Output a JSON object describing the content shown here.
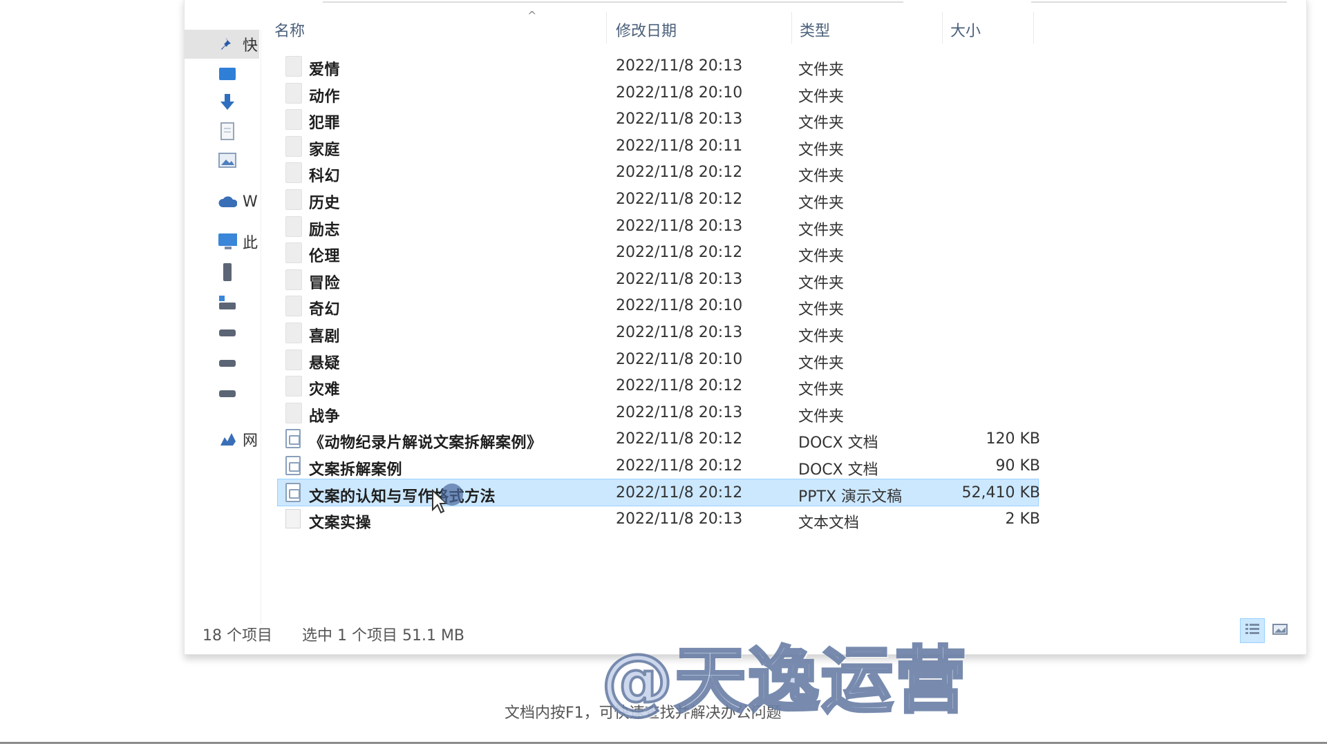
{
  "header": {
    "col_name": "名称",
    "col_date": "修改日期",
    "col_type": "类型",
    "col_size": "大小"
  },
  "sidebar": {
    "items": [
      {
        "icon": "pin-icon",
        "label": "快"
      },
      {
        "icon": "desktop-icon",
        "label": ""
      },
      {
        "icon": "download-arrow-icon",
        "label": ""
      },
      {
        "icon": "document-icon",
        "label": ""
      },
      {
        "icon": "pictures-icon",
        "label": ""
      },
      {
        "icon": "cloud-icon",
        "label": "W"
      },
      {
        "icon": "computer-icon",
        "label": "此"
      },
      {
        "icon": "usb-drive-icon",
        "label": ""
      },
      {
        "icon": "network-drive-icon",
        "label": ""
      },
      {
        "icon": "disk-icon",
        "label": ""
      },
      {
        "icon": "disk-icon",
        "label": ""
      },
      {
        "icon": "disk-icon",
        "label": ""
      },
      {
        "icon": "network-icon",
        "label": "网"
      }
    ]
  },
  "files": [
    {
      "name": "爱情",
      "date": "2022/11/8 20:13",
      "type": "文件夹",
      "size": "",
      "kind": "folder"
    },
    {
      "name": "动作",
      "date": "2022/11/8 20:10",
      "type": "文件夹",
      "size": "",
      "kind": "folder"
    },
    {
      "name": "犯罪",
      "date": "2022/11/8 20:13",
      "type": "文件夹",
      "size": "",
      "kind": "folder"
    },
    {
      "name": "家庭",
      "date": "2022/11/8 20:11",
      "type": "文件夹",
      "size": "",
      "kind": "folder"
    },
    {
      "name": "科幻",
      "date": "2022/11/8 20:12",
      "type": "文件夹",
      "size": "",
      "kind": "folder"
    },
    {
      "name": "历史",
      "date": "2022/11/8 20:12",
      "type": "文件夹",
      "size": "",
      "kind": "folder"
    },
    {
      "name": "励志",
      "date": "2022/11/8 20:13",
      "type": "文件夹",
      "size": "",
      "kind": "folder"
    },
    {
      "name": "伦理",
      "date": "2022/11/8 20:12",
      "type": "文件夹",
      "size": "",
      "kind": "folder"
    },
    {
      "name": "冒险",
      "date": "2022/11/8 20:13",
      "type": "文件夹",
      "size": "",
      "kind": "folder"
    },
    {
      "name": "奇幻",
      "date": "2022/11/8 20:10",
      "type": "文件夹",
      "size": "",
      "kind": "folder"
    },
    {
      "name": "喜剧",
      "date": "2022/11/8 20:13",
      "type": "文件夹",
      "size": "",
      "kind": "folder"
    },
    {
      "name": "悬疑",
      "date": "2022/11/8 20:10",
      "type": "文件夹",
      "size": "",
      "kind": "folder"
    },
    {
      "name": "灾难",
      "date": "2022/11/8 20:12",
      "type": "文件夹",
      "size": "",
      "kind": "folder"
    },
    {
      "name": "战争",
      "date": "2022/11/8 20:13",
      "type": "文件夹",
      "size": "",
      "kind": "folder"
    },
    {
      "name": "《动物纪录片解说文案拆解案例》",
      "date": "2022/11/8 20:12",
      "type": "DOCX 文档",
      "size": "120 KB",
      "kind": "docx"
    },
    {
      "name": "文案拆解案例",
      "date": "2022/11/8 20:12",
      "type": "DOCX 文档",
      "size": "90 KB",
      "kind": "docx"
    },
    {
      "name": "文案的认知与写作格式方法",
      "date": "2022/11/8 20:12",
      "type": "PPTX 演示文稿",
      "size": "52,410 KB",
      "kind": "pptx",
      "selected": true
    },
    {
      "name": "文案实操",
      "date": "2022/11/8 20:13",
      "type": "文本文档",
      "size": "2 KB",
      "kind": "txt"
    }
  ],
  "status": {
    "count": "18 个项目",
    "selection": "选中 1 个项目  51.1 MB"
  },
  "hint": "文档内按F1，可快速查找并解决办公问题",
  "watermark": "@天逸运营",
  "colors": {
    "selection": "#cce8ff",
    "selection_border": "#99d1ff",
    "header_text": "#4a5f7a"
  }
}
